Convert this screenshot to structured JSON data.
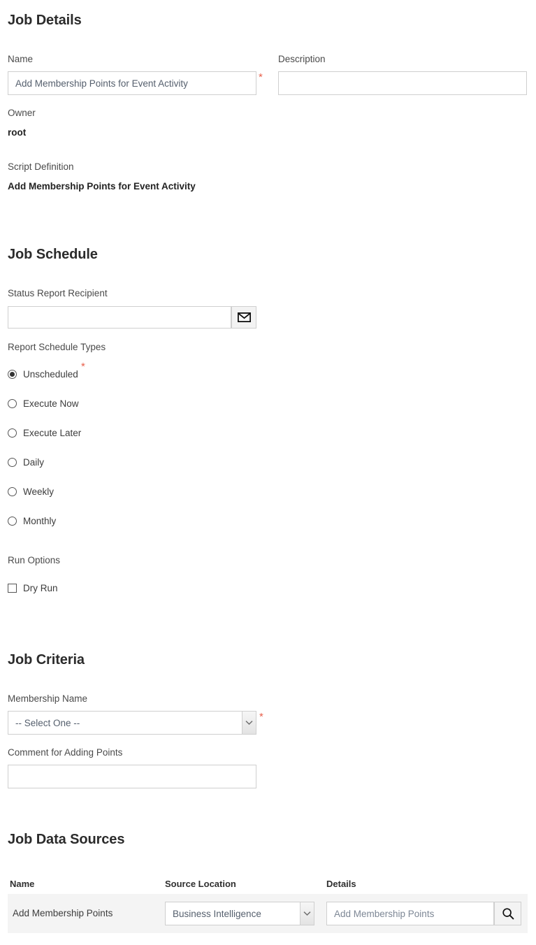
{
  "job_details": {
    "heading": "Job Details",
    "name_label": "Name",
    "name_value": "Add Membership Points for Event Activity",
    "name_required_marker": "*",
    "description_label": "Description",
    "description_value": "",
    "description_placeholder": "",
    "owner_label": "Owner",
    "owner_value": "root",
    "script_definition_label": "Script Definition",
    "script_definition_value": "Add Membership Points for Event Activity"
  },
  "job_schedule": {
    "heading": "Job Schedule",
    "status_report_recipient_label": "Status Report Recipient",
    "status_report_recipient_value": "",
    "status_report_recipient_placeholder": "",
    "email_icon": "envelope-icon",
    "report_schedule_types_label": "Report Schedule Types",
    "report_schedule_required_marker": "*",
    "schedule_options": [
      {
        "label": "Unscheduled",
        "selected": true
      },
      {
        "label": "Execute Now",
        "selected": false
      },
      {
        "label": "Execute Later",
        "selected": false
      },
      {
        "label": "Daily",
        "selected": false
      },
      {
        "label": "Weekly",
        "selected": false
      },
      {
        "label": "Monthly",
        "selected": false
      }
    ],
    "run_options_label": "Run Options",
    "run_options": [
      {
        "label": "Dry Run",
        "checked": false
      }
    ]
  },
  "job_criteria": {
    "heading": "Job Criteria",
    "membership_name_label": "Membership Name",
    "membership_name_selected": "-- Select One --",
    "membership_name_required_marker": "*",
    "comment_label": "Comment for Adding Points",
    "comment_value": "",
    "comment_placeholder": ""
  },
  "job_data_sources": {
    "heading": "Job Data Sources",
    "columns": [
      "Name",
      "Source Location",
      "Details"
    ],
    "rows": [
      {
        "name": "Add Membership Points",
        "source_location": "Business Intelligence",
        "details": "Add Membership Points",
        "search_icon": "search-icon"
      }
    ]
  },
  "colors": {
    "required_asterisk": "#e8604c",
    "row_background": "#f4f4f4",
    "input_border": "#cfcfcf",
    "heading_text": "#2b2b2b"
  }
}
